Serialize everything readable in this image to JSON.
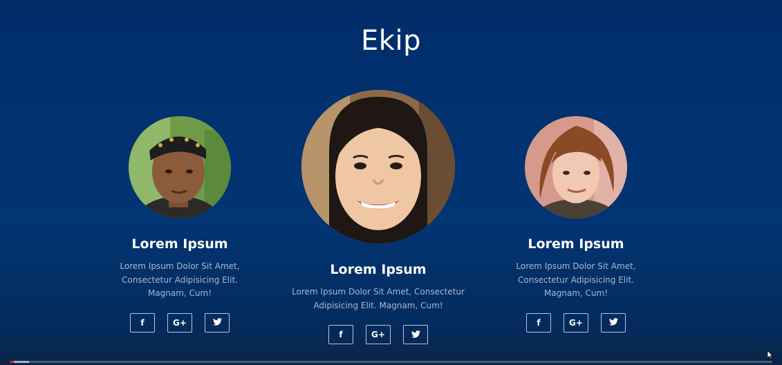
{
  "section": {
    "title": "Ekip"
  },
  "members": [
    {
      "name": "Lorem Ipsum",
      "description_lines": [
        "Lorem Ipsum Dolor Sit Amet,",
        "Consectetur Adipisicing Elit.",
        "Magnam, Cum!"
      ]
    },
    {
      "name": "Lorem Ipsum",
      "description_lines": [
        "Lorem Ipsum Dolor Sit Amet, Consectetur",
        "Adipisicing Elit. Magnam, Cum!"
      ]
    },
    {
      "name": "Lorem Ipsum",
      "description_lines": [
        "Lorem Ipsum Dolor Sit Amet,",
        "Consectetur Adipisicing Elit.",
        "Magnam, Cum!"
      ]
    }
  ],
  "socials": {
    "facebook": {
      "icon": "facebook-icon",
      "glyph": "f"
    },
    "google_plus": {
      "icon": "google-plus-icon",
      "glyph": "G+"
    },
    "twitter": {
      "icon": "twitter-icon",
      "glyph": ""
    }
  },
  "video_progress": {
    "played_fraction": 0.005,
    "buffered_fraction": 0.025
  },
  "colors": {
    "background": "#023574",
    "text": "#ffffff",
    "muted_text": "#a9b8d2",
    "progress": "#e0202a"
  }
}
